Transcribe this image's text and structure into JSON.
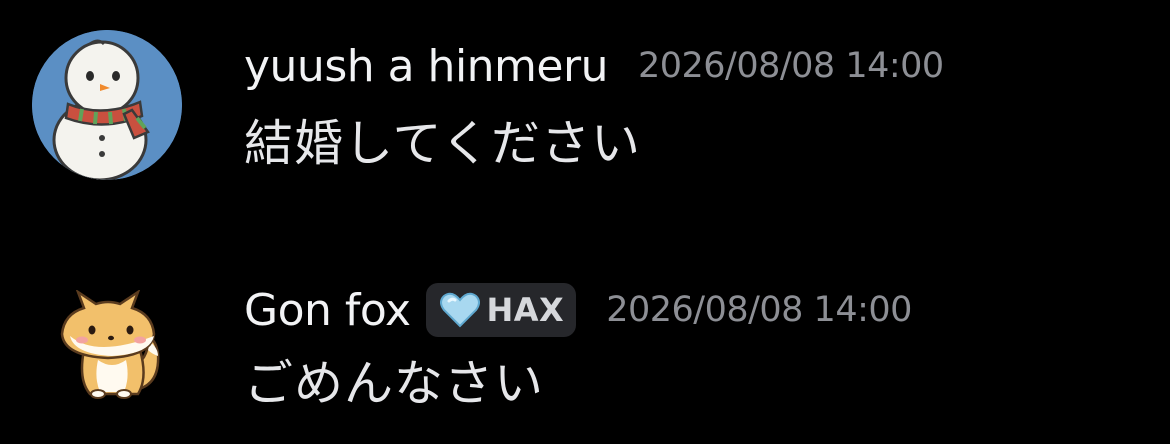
{
  "messages": [
    {
      "author": "yuush a hinmeru",
      "timestamp": "2026/08/08 14:00",
      "text": "結婚してください",
      "avatar_icon": "snowman-avatar-icon"
    },
    {
      "author": "Gon fox",
      "timestamp": "2026/08/08 14:00",
      "text": "ごめんなさい",
      "avatar_icon": "fox-avatar-icon",
      "tag": {
        "label": "HAX",
        "icon": "light-blue-heart-icon",
        "icon_color": "#a8d8f0"
      }
    }
  ],
  "colors": {
    "background": "#000000",
    "username": "#f2f3f5",
    "timestamp": "#8d8f95",
    "message_text": "#e6e7ea",
    "tag_background": "#26272b"
  }
}
